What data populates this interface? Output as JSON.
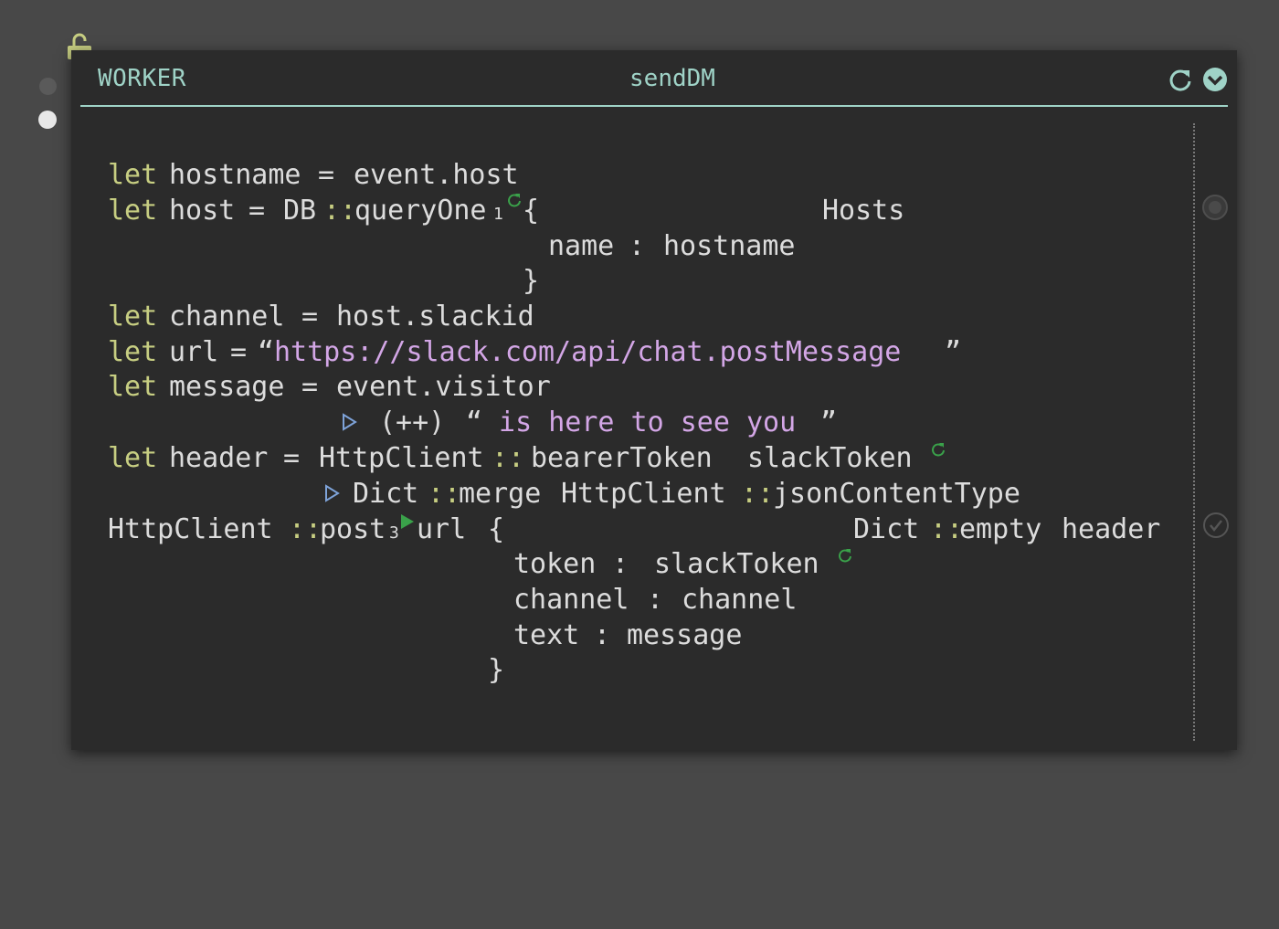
{
  "handler": {
    "kind": "WORKER",
    "name": "sendDM"
  },
  "icons": {
    "lock": "unlock-icon",
    "refresh": "refresh-icon",
    "collapse": "chevron-down-icon",
    "feature_flag": "circle-icon",
    "check": "check-circle-icon",
    "play": "play-icon",
    "pipe": "triangle-right-icon"
  },
  "colors": {
    "accent": "#9fd3c7",
    "keyword": "#c7ce82",
    "string": "#d3a6e6",
    "pipe": "#7ea3d9",
    "play": "#3aa14a"
  },
  "code": {
    "l1": {
      "kw": "let",
      "var": "hostname",
      "eq": "=",
      "expr": "event.host"
    },
    "l2": {
      "kw": "let",
      "var": "host",
      "eq": "=",
      "mod": "DB",
      "sep": "::",
      "fn": "queryOne",
      "ver": "1",
      "open": "{",
      "table": "Hosts"
    },
    "l3": {
      "field": "name",
      "colon": ":",
      "value": "hostname"
    },
    "l4": {
      "close": "}"
    },
    "l5": {
      "kw": "let",
      "var": "channel",
      "eq": "=",
      "expr": "host.slackid"
    },
    "l6": {
      "kw": "let",
      "var": "url",
      "eq": "=",
      "oq": "“",
      "str": "https://slack.com/api/chat.postMessage",
      "cq": "”"
    },
    "l7": {
      "kw": "let",
      "var": "message",
      "eq": "=",
      "expr": "event.visitor"
    },
    "l8": {
      "op": "(++)",
      "oq": "“",
      "str": " is here to see you",
      "cq": "”"
    },
    "l9": {
      "kw": "let",
      "var": "header",
      "eq": "=",
      "mod": "HttpClient",
      "sep": "::",
      "fn": "bearerToken",
      "arg": "slackToken"
    },
    "l10": {
      "mod": "Dict",
      "sep": "::",
      "fn": "merge",
      "mod2": "HttpClient",
      "sep2": "::",
      "fn2": "jsonContentType"
    },
    "l11": {
      "mod": "HttpClient",
      "sep": "::",
      "fn": "post",
      "ver": "3",
      "arg": "url",
      "open": "{",
      "mod2": "Dict",
      "sep2": "::",
      "fn2": "empty",
      "arg2": "header"
    },
    "l12": {
      "field": "token",
      "colon": ":",
      "value": "slackToken"
    },
    "l13": {
      "field": "channel",
      "colon": ":",
      "value": "channel"
    },
    "l14": {
      "field": "text",
      "colon": ":",
      "value": "message"
    },
    "l15": {
      "close": "}"
    }
  }
}
